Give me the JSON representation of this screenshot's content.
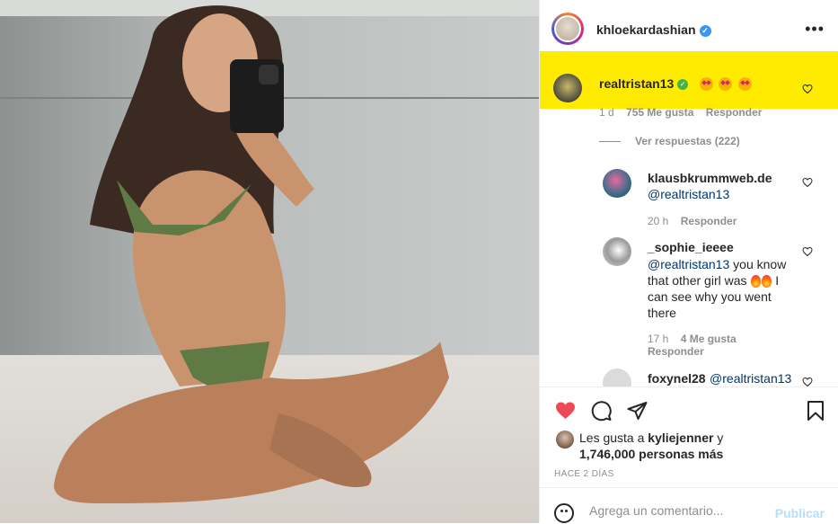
{
  "post": {
    "author": "khloekardashian",
    "verified_icon": "verified-badge-icon",
    "more_icon": "more-horizontal-icon"
  },
  "comments": {
    "top": {
      "user": "realtristan13",
      "badge_icon": "green-check-icon",
      "emojis": [
        "star-struck-emoji",
        "star-struck-emoji",
        "star-struck-emoji"
      ],
      "time": "1 d",
      "likes": "755 Me gusta",
      "reply": "Responder",
      "highlight_color": "#ffeb00"
    },
    "view_replies": "Ver respuestas (222)",
    "replies": [
      {
        "user": "klausbkrummweb.de",
        "mention": "@realtristan13",
        "text": "",
        "time": "20 h",
        "likes": "",
        "reply": "Responder"
      },
      {
        "user": "_sophie_ieeee",
        "mention": "@realtristan13",
        "text_a": " you know that other girl was ",
        "text_b": " I can see why you went there",
        "time": "17 h",
        "likes": "4 Me gusta",
        "reply": "Responder"
      },
      {
        "user": "foxynel28",
        "mention": "@realtristan13"
      }
    ]
  },
  "actions": {
    "like_icon": "heart-filled-icon",
    "comment_icon": "comment-icon",
    "share_icon": "paper-plane-icon",
    "save_icon": "bookmark-icon",
    "like_color": "#ed4956",
    "liked_prefix": "Les gusta a ",
    "liked_user": "kyliejenner",
    "liked_mid": " y",
    "liked_count": "1,746,000 personas más",
    "time_ago": "HACE 2 DÍAS"
  },
  "add_comment": {
    "emoji_icon": "smiley-icon",
    "placeholder": "Agrega un comentario...",
    "publish_label": "Publicar"
  }
}
